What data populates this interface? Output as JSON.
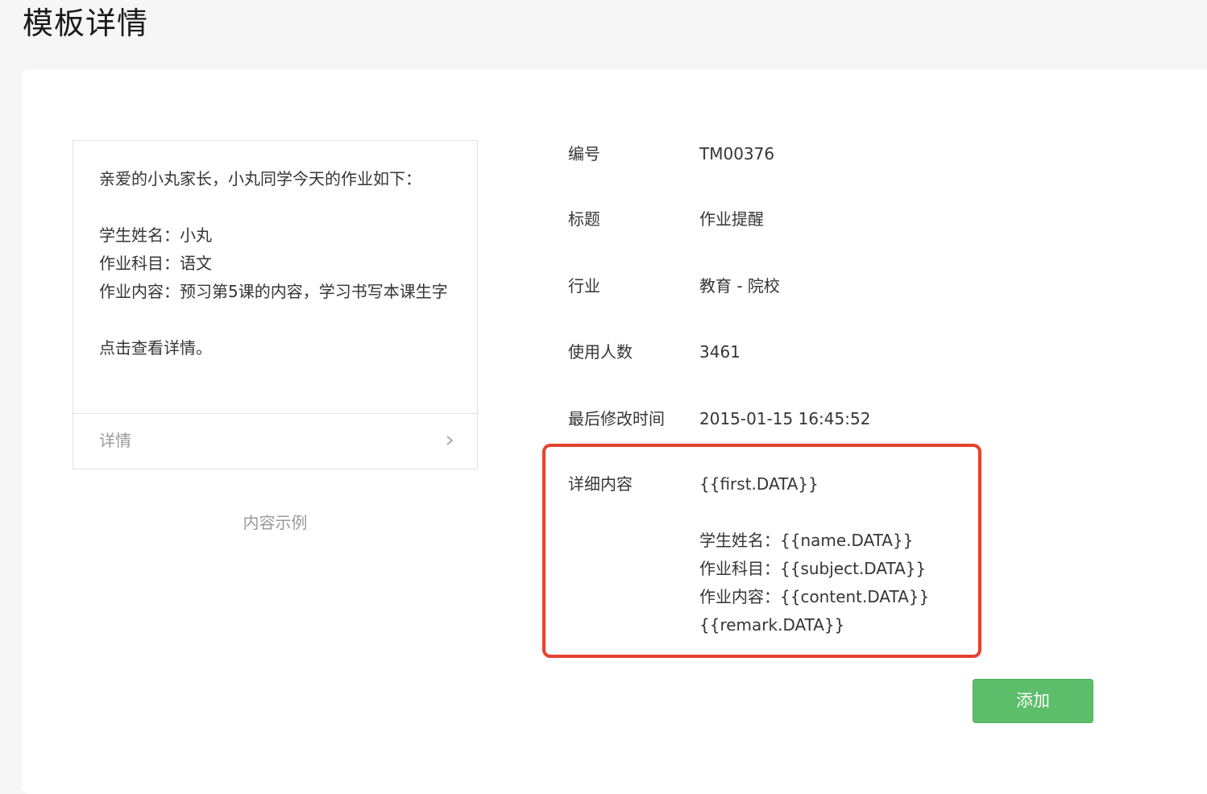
{
  "page": {
    "title": "模板详情"
  },
  "preview": {
    "lines": [
      "亲爱的小丸家长，小丸同学今天的作业如下：",
      "学生姓名：小丸",
      "作业科目：语文",
      "作业内容：预习第5课的内容，学习书写本课生字",
      "点击查看详情。"
    ],
    "footer_label": "详情",
    "caption": "内容示例"
  },
  "info": {
    "id_label": "编号",
    "id_value": "TM00376",
    "title_label": "标题",
    "title_value": "作业提醒",
    "industry_label": "行业",
    "industry_value": "教育 - 院校",
    "users_label": "使用人数",
    "users_value": "3461",
    "modified_label": "最后修改时间",
    "modified_value": "2015-01-15 16:45:52",
    "detail_label": "详细内容",
    "detail_lines": [
      "{{first.DATA}}",
      "学生姓名：{{name.DATA}}",
      "作业科目：{{subject.DATA}}",
      "作业内容：{{content.DATA}}",
      "{{remark.DATA}}"
    ]
  },
  "actions": {
    "add_label": "添加"
  },
  "colors": {
    "highlight_border": "#e8412e",
    "add_button": "#5cbd6a"
  },
  "icons": {
    "footer_chevron": "chevron-right-icon"
  }
}
